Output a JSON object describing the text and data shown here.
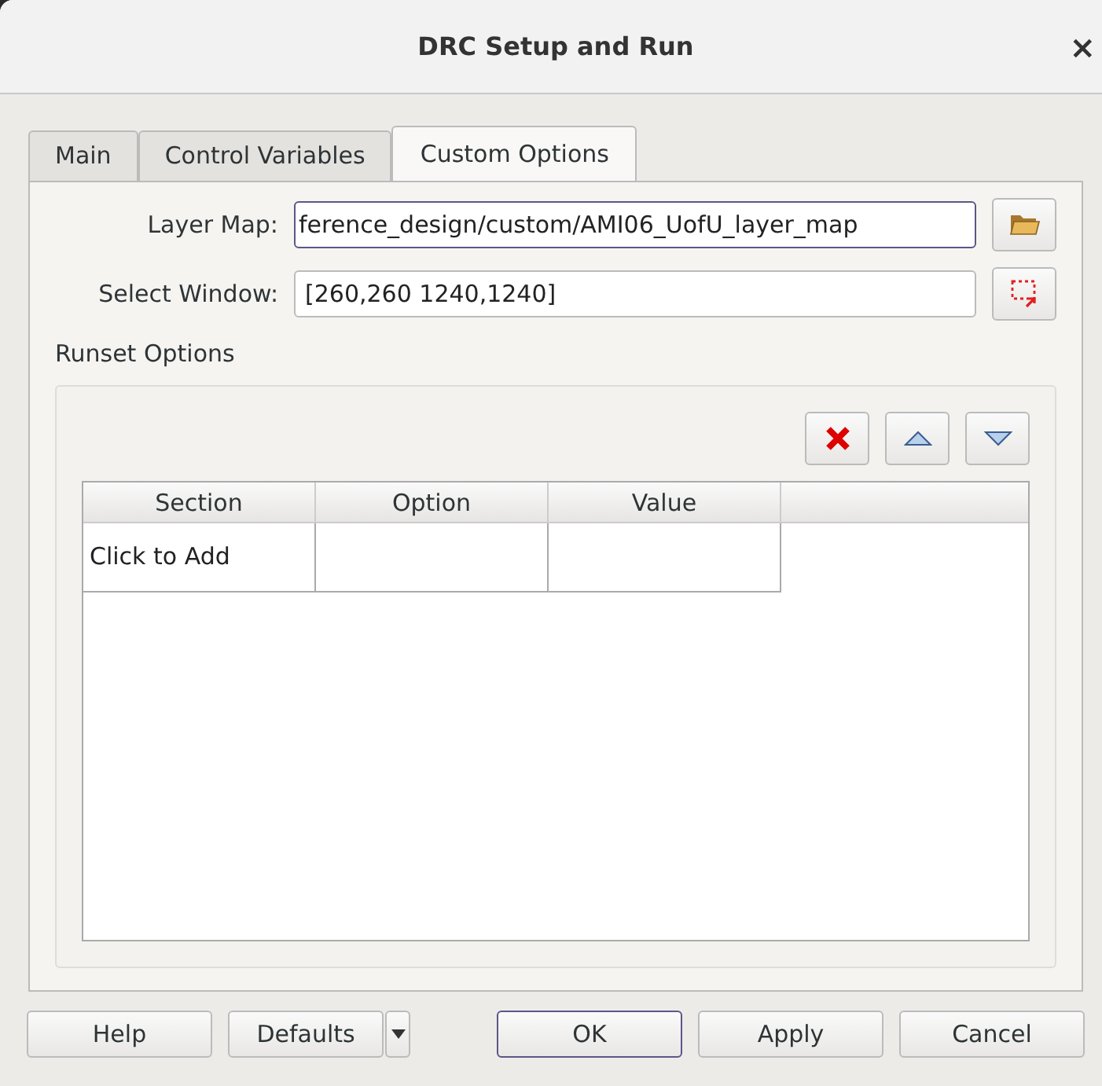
{
  "window": {
    "title": "DRC Setup and Run",
    "close": "×"
  },
  "tabs": [
    {
      "label": "Main",
      "selected": false
    },
    {
      "label": "Control Variables",
      "selected": false
    },
    {
      "label": "Custom Options",
      "selected": true
    }
  ],
  "fields": [
    {
      "label": "Layer Map:",
      "value": "ference_design/custom/AMI06_UofU_layer_map",
      "focused": true,
      "kind": "folder"
    },
    {
      "label": "Select Window:",
      "value": "[260,260 1240,1240]",
      "focused": false,
      "kind": "select"
    }
  ],
  "runset": {
    "title": "Runset Options",
    "columns": [
      "Section",
      "Option",
      "Value"
    ],
    "rows": [
      [
        "Click to Add",
        "",
        ""
      ]
    ]
  },
  "buttons": [
    {
      "label": "Help",
      "kind": "plain",
      "default": false
    },
    {
      "label": "Defaults",
      "kind": "menu",
      "default": false
    },
    {
      "label": "OK",
      "kind": "plain",
      "default": true
    },
    {
      "label": "Apply",
      "kind": "plain",
      "default": false
    },
    {
      "label": "Cancel",
      "kind": "plain",
      "default": false
    }
  ]
}
